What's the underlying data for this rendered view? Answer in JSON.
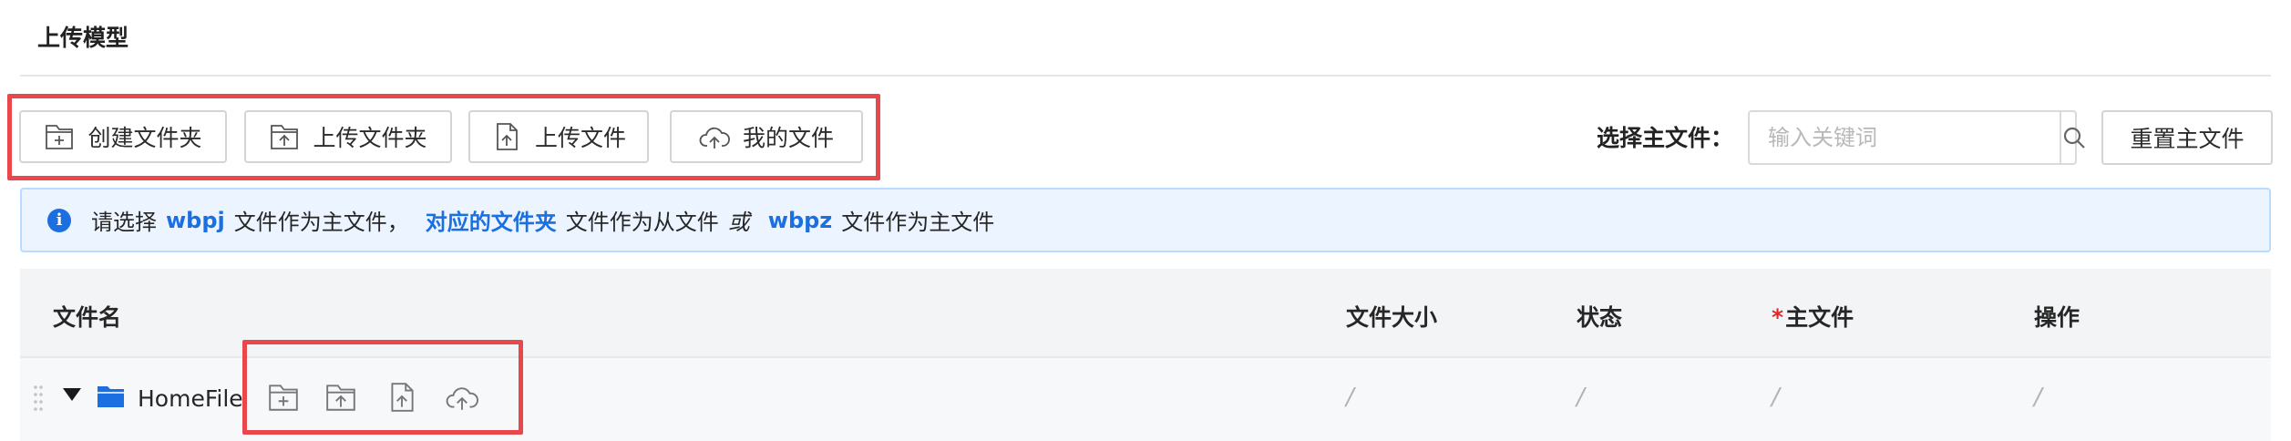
{
  "page": {
    "title": "上传模型"
  },
  "toolbar": {
    "buttons": [
      {
        "label": "创建文件夹",
        "icon": "folder-plus-icon"
      },
      {
        "label": "上传文件夹",
        "icon": "folder-upload-icon"
      },
      {
        "label": "上传文件",
        "icon": "file-upload-icon"
      },
      {
        "label": "我的文件",
        "icon": "cloud-upload-icon"
      }
    ]
  },
  "main_file_selector": {
    "label": "选择主文件：",
    "search_placeholder": "输入关键词",
    "search_value": "",
    "reset_label": "重置主文件"
  },
  "alert": {
    "part1": "请选择",
    "hl1": "wbpj",
    "part2": "文件作为主文件，",
    "hl2": "对应的文件夹",
    "part3": "文件作为从文件",
    "or": "或",
    "hl3": "wbpz",
    "part4": "文件作为主文件"
  },
  "table": {
    "columns": {
      "name": "文件名",
      "size": "文件大小",
      "status": "状态",
      "required_mark": "*",
      "main": "主文件",
      "actions": "操作"
    },
    "rows": [
      {
        "name": "HomeFile",
        "size": "/",
        "status": "/",
        "main": "/",
        "actions": "/",
        "row_icons": [
          "folder-plus-icon",
          "folder-upload-icon",
          "file-upload-icon",
          "cloud-upload-icon"
        ]
      }
    ]
  },
  "colors": {
    "accent": "#1b6fe0",
    "highlight_border": "#e8484c",
    "required": "#e02828",
    "alert_bg": "#ecf5ff"
  }
}
